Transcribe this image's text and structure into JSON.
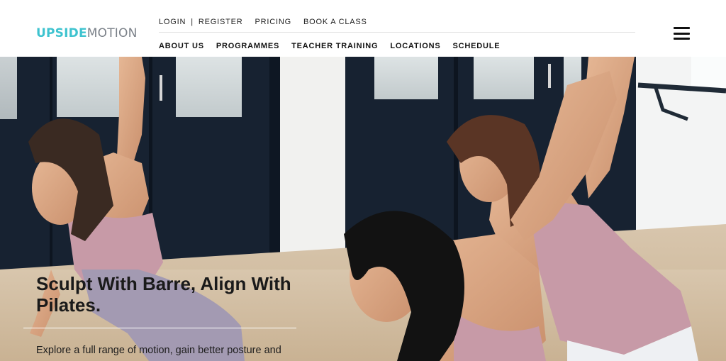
{
  "brand": {
    "logo_part1": "UPSIDE",
    "logo_part2": "MOTION"
  },
  "top_nav": {
    "login": "LOGIN",
    "separator": "|",
    "register": "REGISTER",
    "pricing": "PRICING",
    "book": "BOOK A CLASS"
  },
  "main_nav": [
    {
      "label": "ABOUT US"
    },
    {
      "label": "PROGRAMMES"
    },
    {
      "label": "TEACHER TRAINING"
    },
    {
      "label": "LOCATIONS"
    },
    {
      "label": "SCHEDULE"
    }
  ],
  "menu": {
    "icon": "hamburger-menu-icon"
  },
  "hero": {
    "title": "Sculpt With Barre, Align With Pilates.",
    "subtitle": "Explore a full range of motion, gain better posture and grace that will equip you for all areas of life!"
  },
  "colors": {
    "brand_teal": "#3ec3cf",
    "brand_gray": "#7a8088",
    "text_dark": "#111111",
    "top_wear": "#c79aa7",
    "leggings": "#a39ab2"
  }
}
